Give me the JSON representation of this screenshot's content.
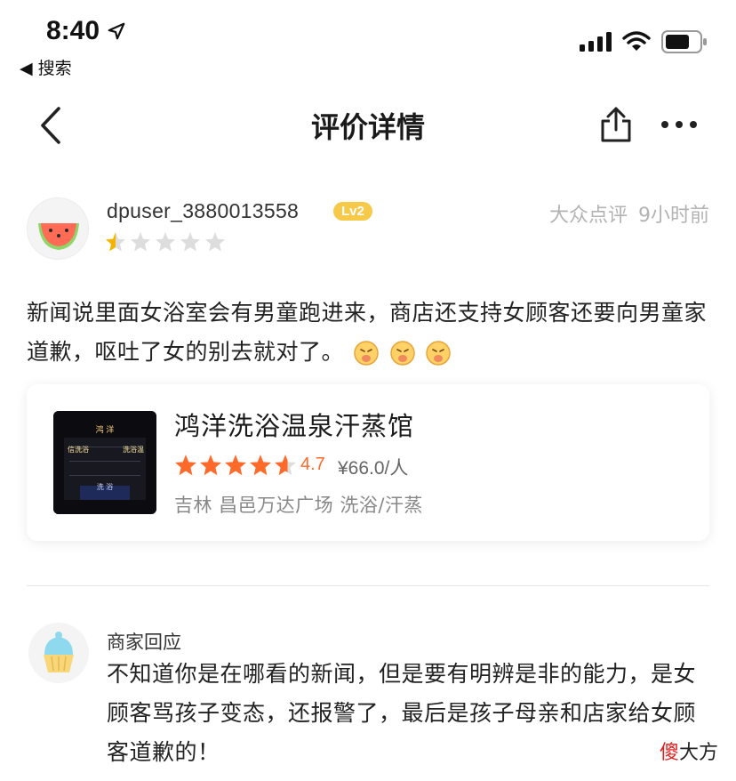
{
  "status_bar": {
    "time": "8:40",
    "back_label": "◀ 搜索"
  },
  "nav": {
    "title": "评价详情"
  },
  "review": {
    "username": "dpuser_3880013558",
    "level": "Lv2",
    "source": "大众点评",
    "time_ago": "9小时前",
    "rating_stars": 0.5,
    "text": "新闻说里面女浴室会有男童跑进来，商店还支持女顾客还要向男童家道歉，呕吐了女的别去就对了。",
    "emoji_count": 3
  },
  "shop": {
    "name": "鸿洋洗浴温泉汗蒸馆",
    "rating": "4.7",
    "price": "¥66.0/人",
    "location": "吉林 昌邑万达广场 洗浴/汗蒸",
    "thumb_sign_top": "鸿 洋",
    "thumb_sign_left": "信洗浴",
    "thumb_sign_right": "洗浴温",
    "thumb_sign_bottom": "洗 浴"
  },
  "reply": {
    "title": "商家回应",
    "text": "不知道你是在哪看的新闻，但是要有明辨是非的能力，是女顾客骂孩子变态，还报警了，最后是孩子母亲和店家给女顾客道歉的！"
  },
  "watermark": {
    "red": "傻",
    "rest": "大方"
  },
  "colors": {
    "star_active": "#ff6a2a",
    "star_inactive": "#dddddd",
    "user_star": "#f5b400",
    "badge": "#f7c948"
  }
}
